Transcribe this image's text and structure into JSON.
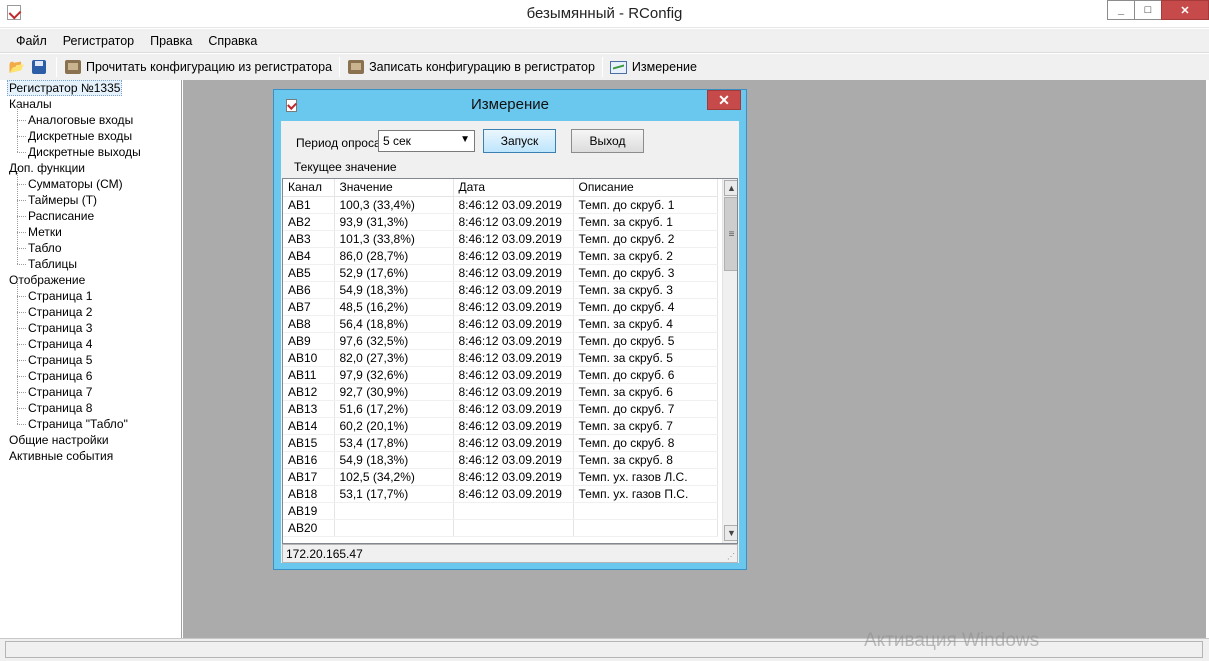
{
  "window": {
    "title": "безымянный - RConfig",
    "min": "_",
    "max": "□",
    "close": "✕"
  },
  "menu": [
    "Файл",
    "Регистратор",
    "Правка",
    "Справка"
  ],
  "toolbar": {
    "read": "Прочитать конфигурацию из регистратора",
    "write": "Записать конфигурацию в регистратор",
    "measure": "Измерение"
  },
  "tree": [
    {
      "label": "Регистратор №1335",
      "level": 0
    },
    {
      "label": "Каналы",
      "level": 1
    },
    {
      "label": "Аналоговые входы",
      "level": 2
    },
    {
      "label": "Дискретные входы",
      "level": 2
    },
    {
      "label": "Дискретные выходы",
      "level": 2
    },
    {
      "label": "Доп. функции",
      "level": 1
    },
    {
      "label": "Сумматоры (СМ)",
      "level": 2
    },
    {
      "label": "Таймеры (Т)",
      "level": 2
    },
    {
      "label": "Расписание",
      "level": 2
    },
    {
      "label": "Метки",
      "level": 2
    },
    {
      "label": "Табло",
      "level": 2
    },
    {
      "label": "Таблицы",
      "level": 2
    },
    {
      "label": "Отображение",
      "level": 1
    },
    {
      "label": "Страница 1",
      "level": 2
    },
    {
      "label": "Страница 2",
      "level": 2
    },
    {
      "label": "Страница 3",
      "level": 2
    },
    {
      "label": "Страница 4",
      "level": 2
    },
    {
      "label": "Страница 5",
      "level": 2
    },
    {
      "label": "Страница 6",
      "level": 2
    },
    {
      "label": "Страница 7",
      "level": 2
    },
    {
      "label": "Страница 8",
      "level": 2
    },
    {
      "label": "Страница \"Табло\"",
      "level": 2
    },
    {
      "label": "Общие настройки",
      "level": 1
    },
    {
      "label": "Активные события",
      "level": 1
    }
  ],
  "dialog": {
    "title": "Измерение",
    "close": "✕",
    "poll_label": "Период опроса",
    "poll_value": "5 сек",
    "start_button": "Запуск",
    "exit_button": "Выход",
    "current_label": "Текущее значение",
    "status": "172.20.165.47",
    "columns": [
      "Канал",
      "Значение",
      "Дата",
      "Описание"
    ],
    "rows": [
      [
        "АВ1",
        "100,3 (33,4%)",
        "8:46:12 03.09.2019",
        "Темп. до скруб. 1"
      ],
      [
        "АВ2",
        "93,9 (31,3%)",
        "8:46:12 03.09.2019",
        "Темп. за скруб. 1"
      ],
      [
        "АВ3",
        "101,3 (33,8%)",
        "8:46:12 03.09.2019",
        "Темп. до скруб. 2"
      ],
      [
        "АВ4",
        "86,0 (28,7%)",
        "8:46:12 03.09.2019",
        "Темп. за скруб. 2"
      ],
      [
        "АВ5",
        "52,9 (17,6%)",
        "8:46:12 03.09.2019",
        "Темп. до скруб. 3"
      ],
      [
        "АВ6",
        "54,9 (18,3%)",
        "8:46:12 03.09.2019",
        "Темп. за скруб. 3"
      ],
      [
        "АВ7",
        "48,5 (16,2%)",
        "8:46:12 03.09.2019",
        "Темп. до скруб. 4"
      ],
      [
        "АВ8",
        "56,4 (18,8%)",
        "8:46:12 03.09.2019",
        "Темп. за скруб. 4"
      ],
      [
        "АВ9",
        "97,6 (32,5%)",
        "8:46:12 03.09.2019",
        "Темп. до скруб. 5"
      ],
      [
        "АВ10",
        "82,0 (27,3%)",
        "8:46:12 03.09.2019",
        "Темп. за скруб. 5"
      ],
      [
        "АВ11",
        "97,9 (32,6%)",
        "8:46:12 03.09.2019",
        "Темп. до скруб. 6"
      ],
      [
        "АВ12",
        "92,7 (30,9%)",
        "8:46:12 03.09.2019",
        "Темп. за скруб. 6"
      ],
      [
        "АВ13",
        "51,6 (17,2%)",
        "8:46:12 03.09.2019",
        "Темп. до скруб. 7"
      ],
      [
        "АВ14",
        "60,2 (20,1%)",
        "8:46:12 03.09.2019",
        "Темп. за скруб. 7"
      ],
      [
        "АВ15",
        "53,4 (17,8%)",
        "8:46:12 03.09.2019",
        "Темп. до скруб. 8"
      ],
      [
        "АВ16",
        "54,9 (18,3%)",
        "8:46:12 03.09.2019",
        "Темп. за скруб. 8"
      ],
      [
        "АВ17",
        "102,5 (34,2%)",
        "8:46:12 03.09.2019",
        "Темп. ух. газов Л.С."
      ],
      [
        "АВ18",
        "53,1 (17,7%)",
        "8:46:12 03.09.2019",
        "Темп. ух. газов П.С."
      ],
      [
        "АВ19",
        "",
        "",
        ""
      ],
      [
        "АВ20",
        "",
        "",
        ""
      ]
    ]
  },
  "watermark": "Активация Windows",
  "icons": {
    "app": "rconfig-app-icon",
    "open": "open-folder-icon",
    "save": "save-icon",
    "read": "read-config-icon",
    "write": "write-config-icon",
    "measure": "measure-icon"
  }
}
